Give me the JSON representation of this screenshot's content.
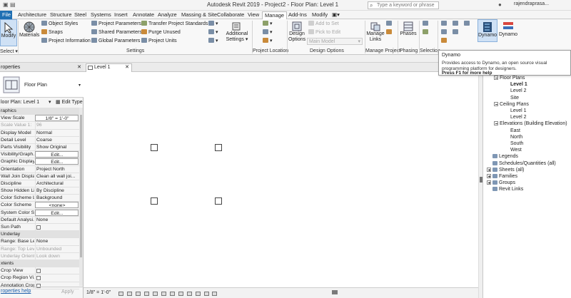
{
  "window": {
    "title": "Autodesk Revit 2019 - Project2 - Floor Plan: Level 1",
    "search_placeholder": "Type a keyword or phrase",
    "user": "rajendraprasa..."
  },
  "menu": {
    "tabs": [
      "File",
      "Architecture",
      "Structure",
      "Steel",
      "Systems",
      "Insert",
      "Annotate",
      "Analyze",
      "Massing & Site",
      "Collaborate",
      "View",
      "Manage",
      "Add-Ins",
      "Modify"
    ]
  },
  "ribbon": {
    "modify": "Modify",
    "select": "Select",
    "materials": "Materials",
    "settings_items": [
      "Object Styles",
      "Snaps",
      "Project Information",
      "Project Parameters",
      "Shared Parameters",
      "Global Parameters",
      "Transfer Project Standards",
      "Purge Unused",
      "Project Units"
    ],
    "additional_settings": "Additional Settings",
    "design_options": "Design Options",
    "add_to_set": "Add to Set",
    "pick_to_edit": "Pick to Edit",
    "main_model": "Main Model",
    "manage_links": "Manage Links",
    "phases": "Phases",
    "dynamo": "Dynamo",
    "dynamo_player": "Dynamo",
    "panels": {
      "select": "Select",
      "settings": "Settings",
      "project_location": "Project Location",
      "design_options": "Design Options",
      "manage_project": "Manage Project",
      "phasing": "Phasing",
      "selection": "Selection"
    }
  },
  "tooltip": {
    "title": "Dynamo",
    "description": "Provides access to Dynamo, an open source visual programming platform for designers.",
    "help": "Press F1 for more help"
  },
  "properties": {
    "header": "roperties",
    "type_name": "Floor Plan",
    "instance": "loor Plan: Level 1",
    "edit_type": "Edit Type",
    "rows": [
      {
        "k": "raphics",
        "v": "",
        "cat": true
      },
      {
        "k": "View Scale",
        "v": "1/8\" = 1'-0\"",
        "boxed": true
      },
      {
        "k": "Scale Value    1:",
        "v": "96",
        "grey": true
      },
      {
        "k": "Display Model",
        "v": "Normal"
      },
      {
        "k": "Detail Level",
        "v": "Coarse"
      },
      {
        "k": "Parts Visibility",
        "v": "Show Original"
      },
      {
        "k": "Visibility/Graph...",
        "v": "Edit...",
        "boxed": true
      },
      {
        "k": "Graphic Display...",
        "v": "Edit...",
        "boxed": true
      },
      {
        "k": "Orientation",
        "v": "Project North"
      },
      {
        "k": "Wall Join Display",
        "v": "Clean all wall joi..."
      },
      {
        "k": "Discipline",
        "v": "Architectural"
      },
      {
        "k": "Show Hidden Li...",
        "v": "By Discipline"
      },
      {
        "k": "Color Scheme L...",
        "v": "Background"
      },
      {
        "k": "Color Scheme",
        "v": "<none>",
        "boxed": true
      },
      {
        "k": "System Color S...",
        "v": "Edit...",
        "boxed": true
      },
      {
        "k": "Default Analysi...",
        "v": "None"
      },
      {
        "k": "Sun Path",
        "v": "",
        "check": true
      },
      {
        "k": "Underlay",
        "v": "",
        "cat": true
      },
      {
        "k": "Range: Base Le...",
        "v": "None"
      },
      {
        "k": "Range: Top Level",
        "v": "Unbounded",
        "grey": true
      },
      {
        "k": "Underlay Orient...",
        "v": "Look down",
        "grey": true
      },
      {
        "k": "xtents",
        "v": "",
        "cat": true
      },
      {
        "k": "Crop View",
        "v": "",
        "check": true
      },
      {
        "k": "Crop Region Vi...",
        "v": "",
        "check": true
      },
      {
        "k": "Annotation Crop",
        "v": "",
        "check": true
      }
    ],
    "help_link": "roperties help",
    "apply": "Apply"
  },
  "view": {
    "tab_label": "Level 1",
    "scale": "1/8\" = 1'-0\""
  },
  "browser": {
    "items": [
      {
        "label": "Floor Plans",
        "level": 1,
        "exp": "minus"
      },
      {
        "label": "Level 1",
        "level": 2,
        "bold": true
      },
      {
        "label": "Level 2",
        "level": 2
      },
      {
        "label": "Site",
        "level": 2
      },
      {
        "label": "Ceiling Plans",
        "level": 1,
        "exp": "minus"
      },
      {
        "label": "Level 1",
        "level": 2
      },
      {
        "label": "Level 2",
        "level": 2
      },
      {
        "label": "Elevations (Building Elevation)",
        "level": 1,
        "exp": "minus"
      },
      {
        "label": "East",
        "level": 2
      },
      {
        "label": "North",
        "level": 2
      },
      {
        "label": "South",
        "level": 2
      },
      {
        "label": "West",
        "level": 2
      },
      {
        "label": "Legends",
        "level": 0,
        "icon": true
      },
      {
        "label": "Schedules/Quantities (all)",
        "level": 0,
        "icon": true
      },
      {
        "label": "Sheets (all)",
        "level": 0,
        "exp": "plus",
        "icon": true
      },
      {
        "label": "Families",
        "level": 0,
        "exp": "plus",
        "icon": true
      },
      {
        "label": "Groups",
        "level": 0,
        "exp": "plus",
        "icon": true
      },
      {
        "label": "Revit Links",
        "level": 0,
        "icon": true
      }
    ]
  },
  "colors": {
    "file_tab": "#1f6fb3",
    "accent": "#1b5fab"
  }
}
